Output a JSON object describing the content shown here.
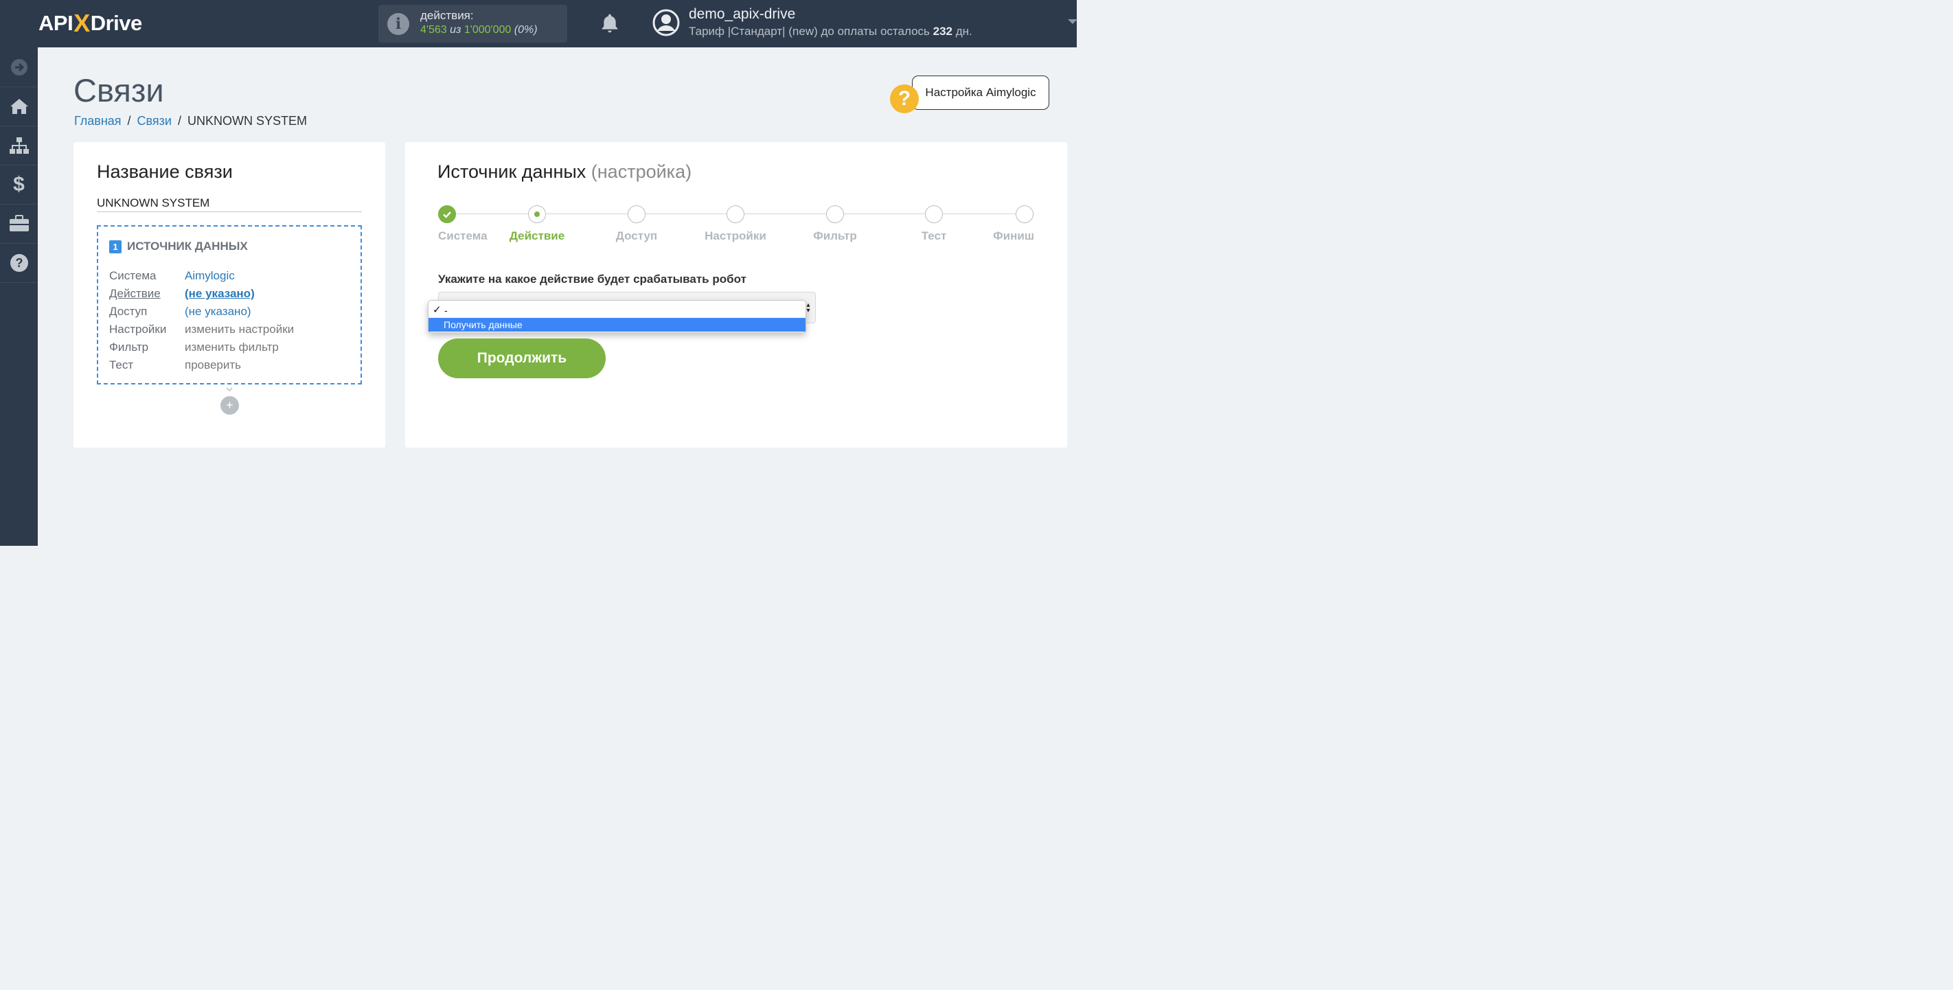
{
  "logo": {
    "text_left": "API",
    "text_x": "X",
    "text_right": "Drive"
  },
  "header": {
    "actions_label": "действия:",
    "actions_used": "4'563",
    "actions_of": "из",
    "actions_total": "1'000'000",
    "actions_percent": "(0%)",
    "username": "demo_apix-drive",
    "tariff_text": "Тариф |Стандарт| (new) до оплаты осталось",
    "tariff_days": "232",
    "tariff_days_unit": "дн."
  },
  "sidebar": {
    "items": [
      {
        "icon": "arrow-right-circle-icon"
      },
      {
        "icon": "home-icon"
      },
      {
        "icon": "sitemap-icon"
      },
      {
        "icon": "dollar-icon"
      },
      {
        "icon": "briefcase-icon"
      },
      {
        "icon": "question-circle-icon"
      }
    ]
  },
  "page": {
    "title": "Связи",
    "breadcrumb": [
      "Главная",
      "Связи",
      "UNKNOWN SYSTEM"
    ],
    "help_button": "Настройка Aimylogic",
    "help_badge": "?"
  },
  "left_card": {
    "title": "Название связи",
    "connection_name": "UNKNOWN SYSTEM",
    "source": {
      "number": "1",
      "heading": "ИСТОЧНИК ДАННЫХ",
      "rows": [
        {
          "key": "Система",
          "value": "Aimylogic"
        },
        {
          "key": "Действие",
          "value": "(не указано)"
        },
        {
          "key": "Доступ",
          "value": "(не указано)"
        },
        {
          "key": "Настройки",
          "value": "изменить настройки"
        },
        {
          "key": "Фильтр",
          "value": "изменить фильтр"
        },
        {
          "key": "Тест",
          "value": "проверить"
        }
      ]
    },
    "add_button": "+"
  },
  "right_card": {
    "title": "Источник данных",
    "title_sub": "(настройка)",
    "steps": [
      "Система",
      "Действие",
      "Доступ",
      "Настройки",
      "Фильтр",
      "Тест",
      "Финиш"
    ],
    "steps_done": 1,
    "step_active": 2,
    "field_label": "Укажите на какое действие будет срабатывать робот",
    "dropdown": {
      "options": [
        "-",
        "Получить данные"
      ],
      "checked": "-",
      "highlighted": "Получить данные"
    },
    "continue_button": "Продолжить"
  },
  "colors": {
    "topbar": "#2d3a4b",
    "accent_green": "#7cb342",
    "link_blue": "#2a7ab8",
    "dashed_blue": "#3b8fe0",
    "help_yellow": "#f5b82e"
  }
}
